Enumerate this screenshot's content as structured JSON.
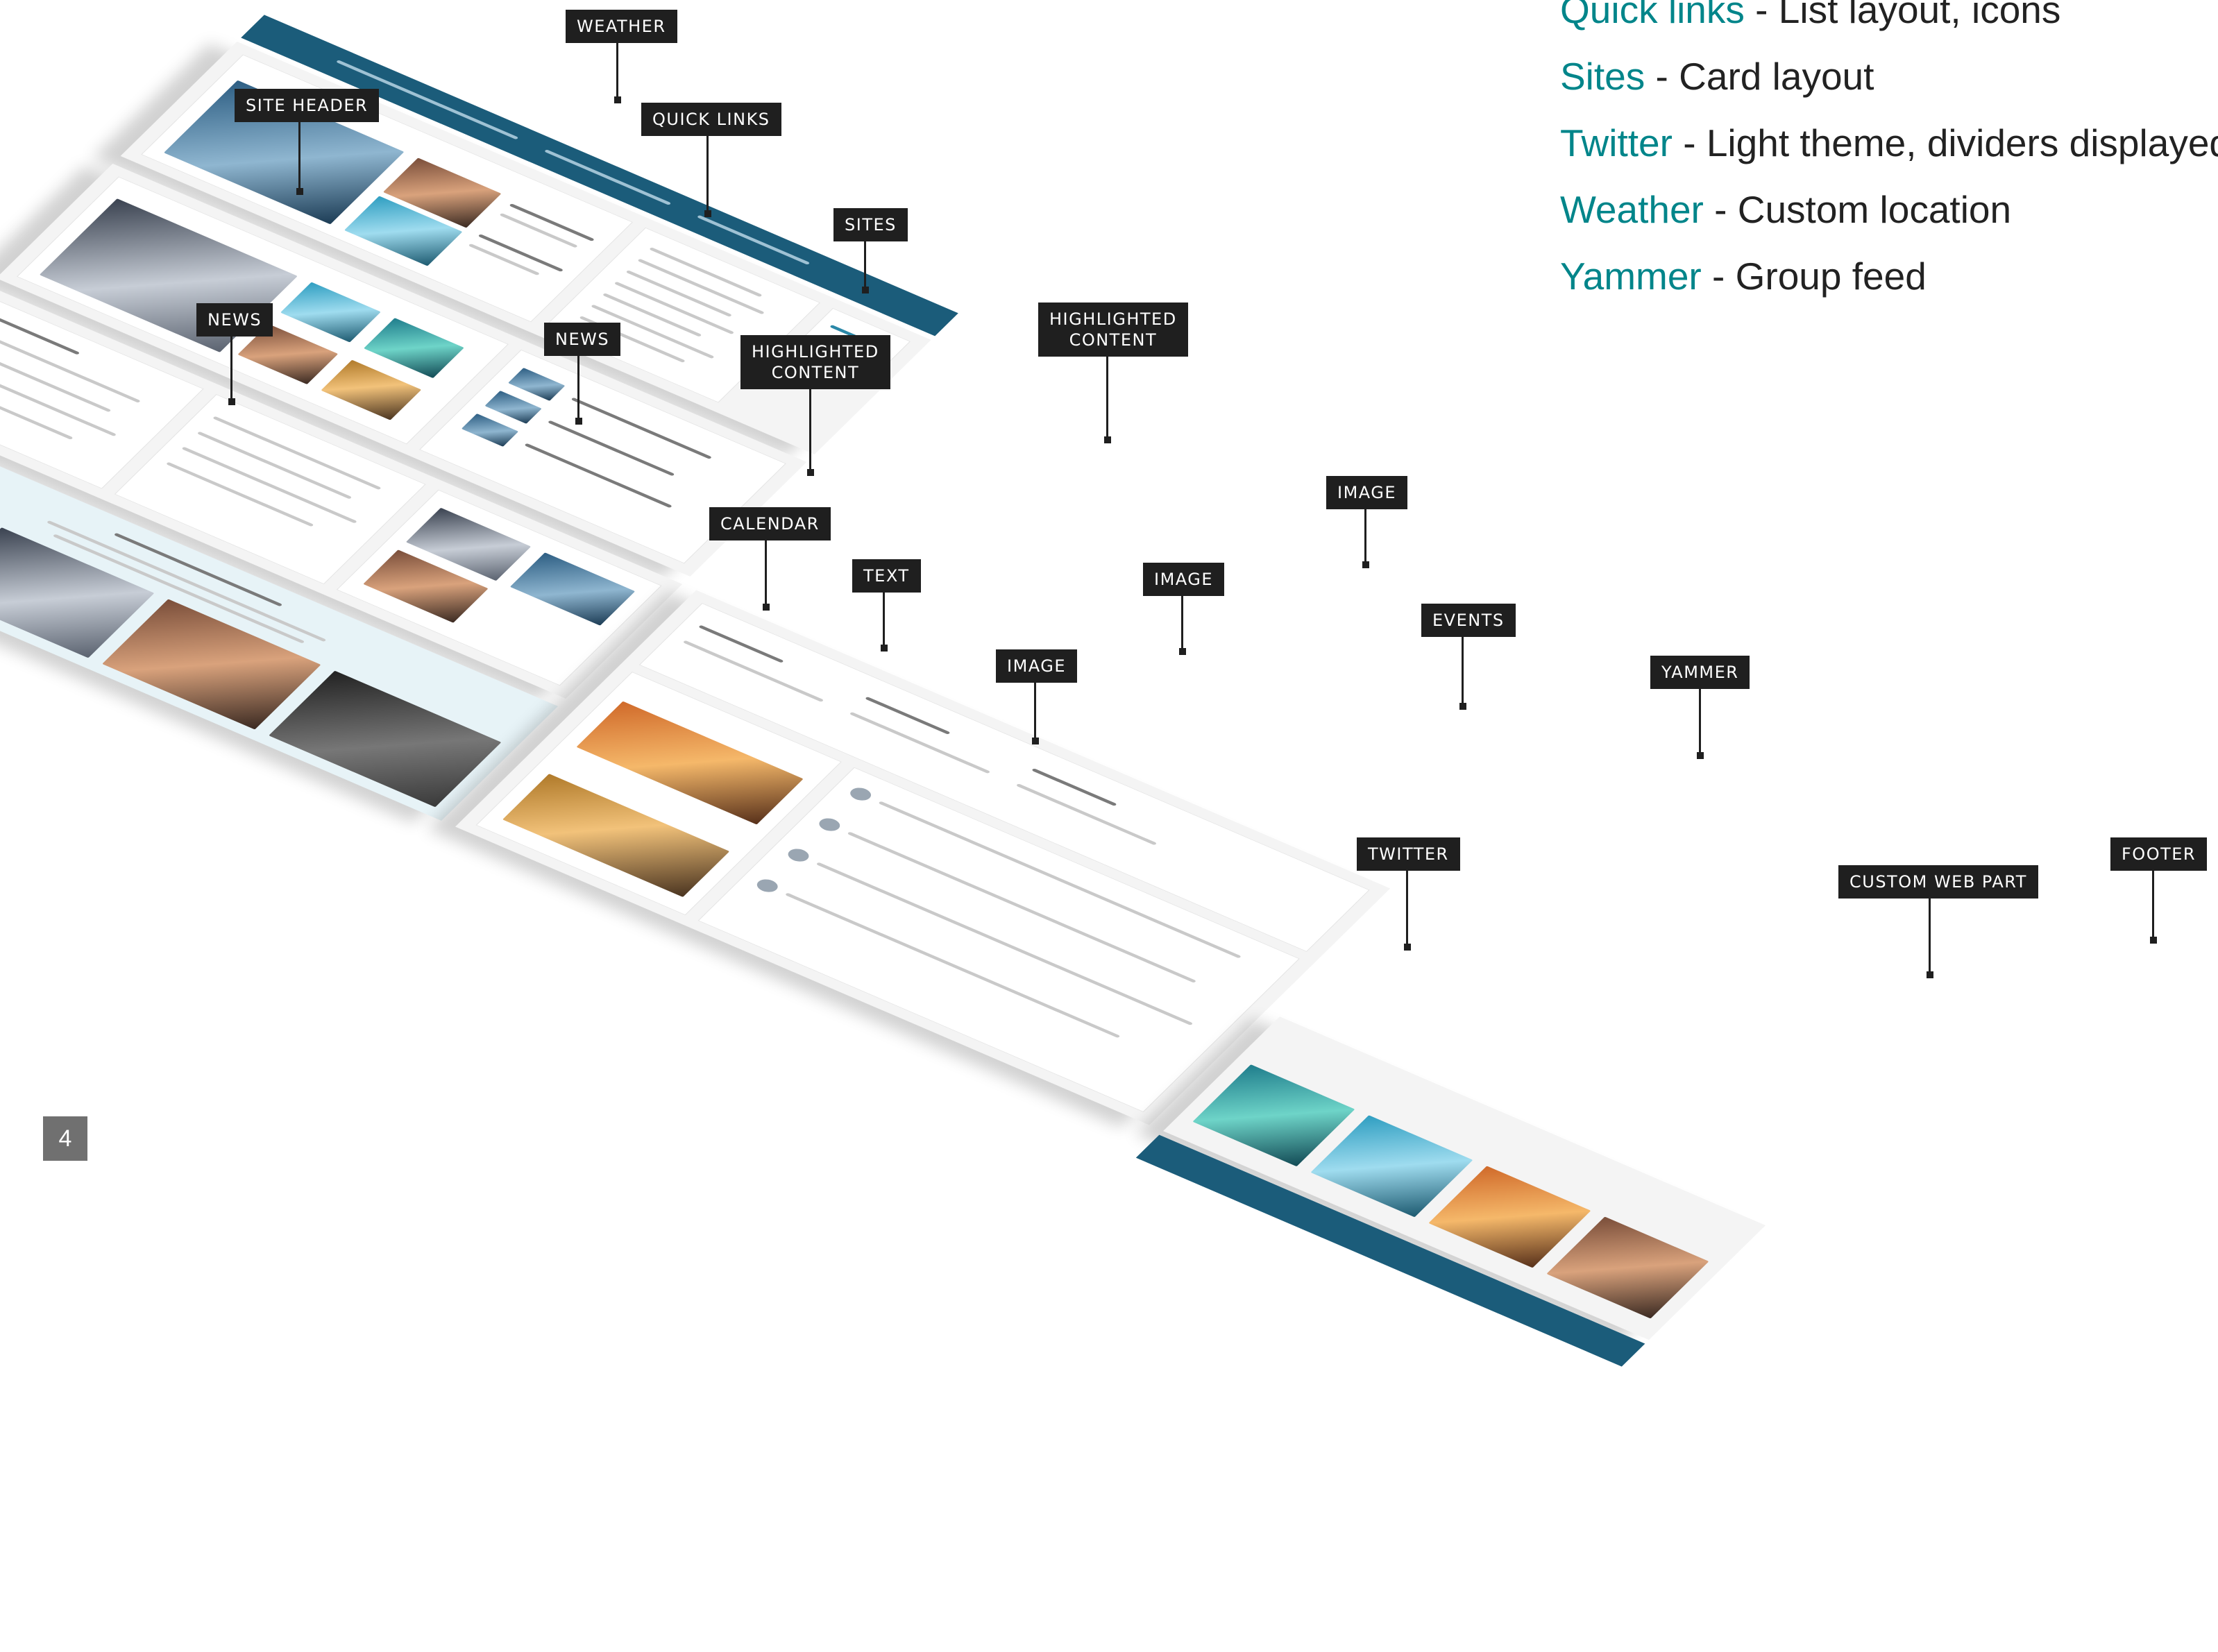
{
  "legend": [
    {
      "name": "Quick links",
      "description": " - List layout, icons"
    },
    {
      "name": "Sites",
      "description": " - Card layout"
    },
    {
      "name": "Twitter",
      "description": " - Light theme, dividers displayed"
    },
    {
      "name": "Weather",
      "description": " - Custom location"
    },
    {
      "name": "Yammer",
      "description": " - Group feed"
    }
  ],
  "callouts": {
    "weather": "WEATHER",
    "site_header": "SITE HEADER",
    "quick_links": "QUICK LINKS",
    "sites": "SITES",
    "news_1": "NEWS",
    "news_2": "NEWS",
    "highlighted_content_1": "HIGHLIGHTED\nCONTENT",
    "highlighted_content_2": "HIGHLIGHTED\nCONTENT",
    "image_1": "IMAGE",
    "image_2": "IMAGE",
    "image_3": "IMAGE",
    "calendar": "CALENDAR",
    "text": "TEXT",
    "events": "EVENTS",
    "yammer": "YAMMER",
    "twitter": "TWITTER",
    "custom_web_part": "CUSTOM WEB PART",
    "footer": "FOOTER"
  },
  "page_number": "4",
  "colors": {
    "accent": "#00858a",
    "callout_bg": "#1f1f1f",
    "site_bar": "#1b5c7a"
  }
}
